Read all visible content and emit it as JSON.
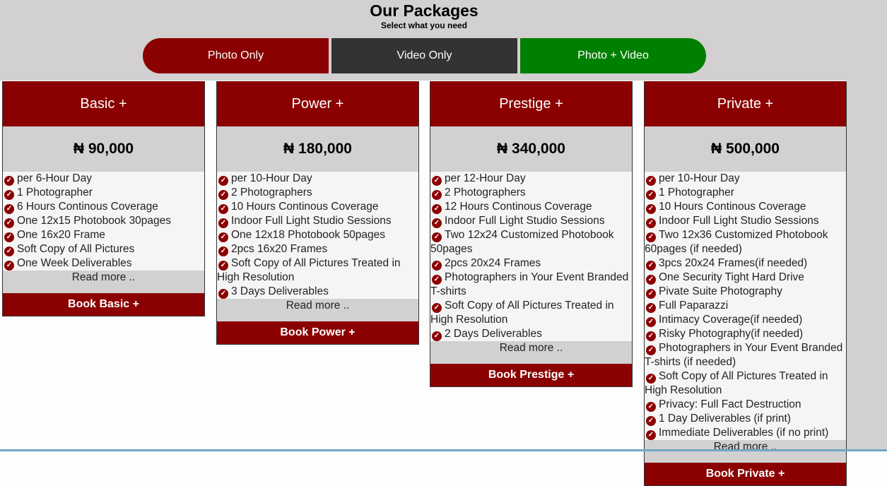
{
  "header": {
    "title": "Our Packages",
    "subtitle": "Select what you need"
  },
  "tabs": [
    {
      "label": "Photo Only",
      "color": "#8b0000"
    },
    {
      "label": "Video Only",
      "color": "#333333"
    },
    {
      "label": "Photo + Video",
      "color": "#008000"
    }
  ],
  "packages": [
    {
      "name": "Basic +",
      "price": "₦ 90,000",
      "features": [
        "per 6-Hour Day",
        "1 Photographer",
        "6 Hours Continous Coverage",
        "One 12x15 Photobook 30pages",
        "One 16x20 Frame",
        "Soft Copy of All Pictures",
        "One Week Deliverables"
      ],
      "read_more": "Read more ..",
      "book": "Book Basic +"
    },
    {
      "name": "Power +",
      "price": "₦ 180,000",
      "features": [
        "per 10-Hour Day",
        "2 Photographers",
        "10 Hours Continous Coverage",
        "Indoor Full Light Studio Sessions",
        "One 12x18 Photobook 50pages",
        "2pcs 16x20 Frames",
        "Soft Copy of All Pictures Treated in High Resolution",
        "3 Days Deliverables"
      ],
      "read_more": "Read more ..",
      "book": "Book Power +"
    },
    {
      "name": "Prestige +",
      "price": "₦ 340,000",
      "features": [
        "per 12-Hour Day",
        "2 Photographers",
        "12 Hours Continous Coverage",
        "Indoor Full Light Studio Sessions",
        "Two 12x24 Customized Photobook 50pages",
        "2pcs 20x24 Frames",
        "Photographers in Your Event Branded T-shirts",
        "Soft Copy of All Pictures Treated in High Resolution",
        "2 Days Deliverables"
      ],
      "read_more": "Read more ..",
      "book": "Book Prestige +"
    },
    {
      "name": "Private +",
      "price": "₦ 500,000",
      "features": [
        "per 10-Hour Day",
        "1 Photographer",
        "10 Hours Continous Coverage",
        "Indoor Full Light Studio Sessions",
        "Two 12x36 Customized Photobook 60pages (if needed)",
        "3pcs 20x24 Frames(if needed)",
        "One Security Tight Hard Drive",
        "Pivate Suite Photography",
        "Full Paparazzi",
        "Intimacy Coverage(if needed)",
        "Risky Photography(if needed)",
        "Photographers in Your Event Branded T-shirts (if needed)",
        "Soft Copy of All Pictures Treated in High Resolution",
        "Privacy: Full Fact Destruction",
        "1 Day Deliverables (if print)",
        "Immediate Deliverables (if no print)"
      ],
      "read_more": "Read more ..",
      "book": "Book Private +"
    }
  ],
  "icons": {
    "feature": "check-circle-icon"
  },
  "colors": {
    "brand": "#8b0000",
    "accent_green": "#008000",
    "dark": "#333333",
    "band": "#d2d0d0"
  }
}
